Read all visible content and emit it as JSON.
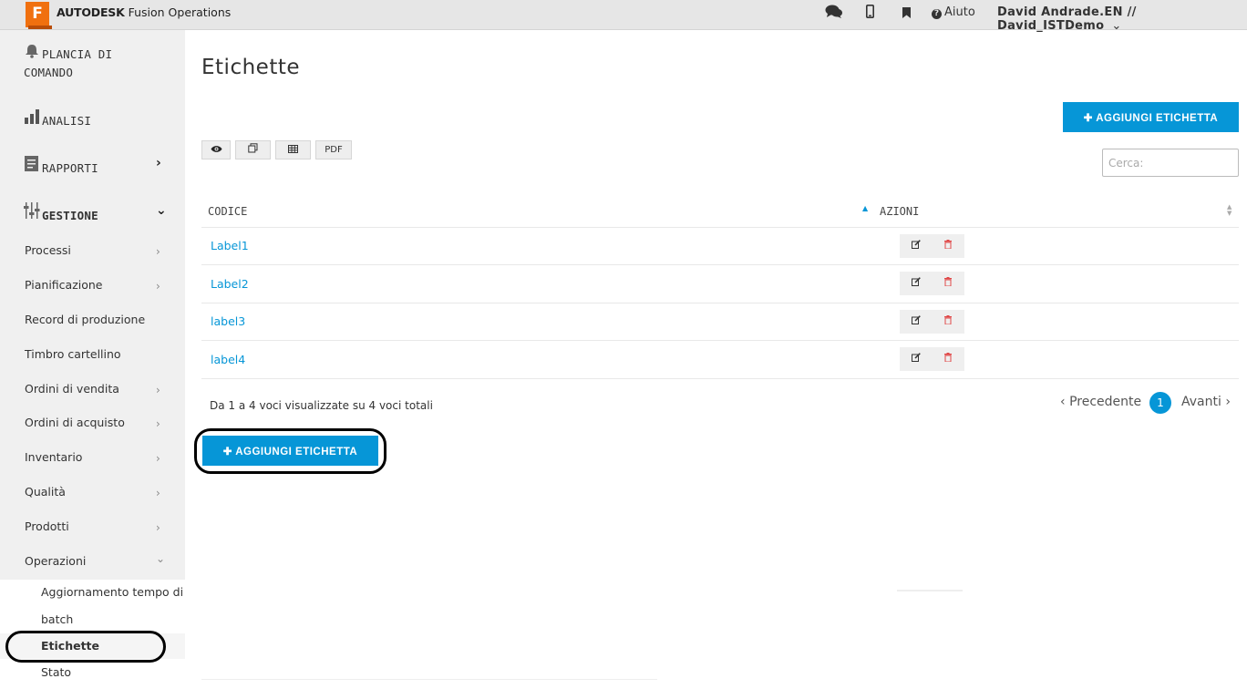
{
  "topbar": {
    "logo_letter": "F",
    "brand_bold": "AUTODESK",
    "brand_rest": " Fusion Operations",
    "icons": [
      "chat-icon",
      "mobile-icon",
      "bookmark-icon"
    ],
    "help_label": "Aiuto",
    "user": "David Andrade.EN // David_ISTDemo"
  },
  "sidebar": {
    "main": [
      {
        "label": "PLANCIA DI",
        "label2": "COMANDO",
        "icon": "bell-icon"
      },
      {
        "label": "ANALISI",
        "icon": "bar-chart-icon"
      },
      {
        "label": "RAPPORTI",
        "icon": "report-icon"
      },
      {
        "label": "GESTIONE",
        "icon": "sliders-icon"
      }
    ],
    "sub": [
      "Processi",
      "Pianificazione",
      "Record di produzione",
      "Timbro cartellino",
      "Ordini di vendita",
      "Ordini di acquisto",
      "Inventario",
      "Qualità",
      "Prodotti",
      "Operazioni"
    ],
    "subsub": [
      "Aggiornamento tempo di",
      "batch",
      "Etichette",
      "Stato"
    ]
  },
  "main": {
    "title": "Etichette",
    "add_button": "AGGIUNGI ETICHETTA",
    "tools": [
      "view-icon",
      "copy-icon",
      "table-icon",
      "PDF"
    ],
    "search_placeholder": "Cerca:",
    "columns": [
      "CODICE",
      "AZIONI"
    ],
    "rows": [
      "Label1",
      "Label2",
      "label3",
      "label4"
    ],
    "info": "Da 1 a 4 voci visualizzate su 4 voci totali",
    "pager": {
      "prev": "Precedente",
      "page": "1",
      "next": "Avanti"
    }
  },
  "colors": {
    "accent": "#0696d7",
    "logo": "#f0700f",
    "delete": "#e04848"
  }
}
